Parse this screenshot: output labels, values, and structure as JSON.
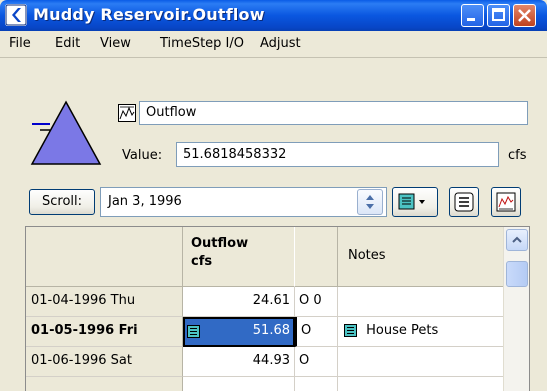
{
  "window": {
    "title": "Muddy Reservoir.Outflow"
  },
  "menu": [
    "File",
    "Edit",
    "View",
    "TimeStep I/O",
    "Adjust"
  ],
  "slot": {
    "name": "Outflow",
    "value_label": "Value:",
    "value": "51.6818458332",
    "units": "cfs"
  },
  "scroll": {
    "button_label": "Scroll:",
    "date": "Jan 3, 1996"
  },
  "table": {
    "header_outflow": "Outflow",
    "header_units": "cfs",
    "header_notes": "Notes",
    "rows": [
      {
        "date": "01-04-1996 Thu",
        "value": "24.61",
        "flag": "O 0",
        "note": ""
      },
      {
        "date": "01-05-1996 Fri",
        "value": "51.68",
        "flag": "O",
        "note": "House Pets"
      },
      {
        "date": "01-06-1996 Sat",
        "value": "44.93",
        "flag": "O",
        "note": ""
      }
    ]
  },
  "colors": {
    "titlebar": "#0a57e0",
    "selection": "#316ac5",
    "reservoir_icon": "#7b78e6"
  },
  "icons": [
    "app-icon",
    "minimize-icon",
    "maximize-icon",
    "close-icon",
    "reservoir-icon",
    "series-slot-icon",
    "spinner-icon",
    "note-dropdown-icon",
    "list-icon",
    "plot-icon",
    "note-icon"
  ]
}
